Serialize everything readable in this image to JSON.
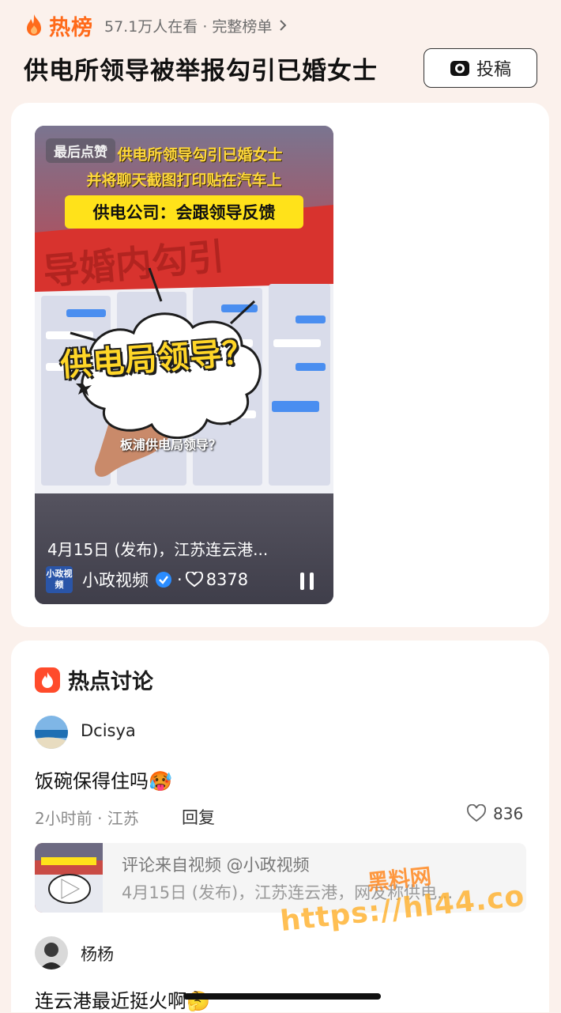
{
  "header": {
    "hot_label": "热榜",
    "viewers": "57.1万人在看 · 完整榜单",
    "title": "供电所领导被举报勾引已婚女士",
    "submit_label": "投稿"
  },
  "video": {
    "last_watched": "最后点赞",
    "caption_line1": "供电所领导勾引已婚女士",
    "caption_line2": "并将聊天截图打印贴在汽车上",
    "caption_line3": "供电公司：会跟领导反馈",
    "burst_text": "供电局领导？",
    "subcaption": "板浦供电局领导？",
    "description": "4月15日 (发布)，江苏连云港...",
    "source_logo": "小政视频",
    "source_name": "小政视频",
    "likes": "8378"
  },
  "discussion": {
    "title": "热点讨论",
    "comments": [
      {
        "user": "Dcisya",
        "text": "饭碗保得住吗🥵",
        "meta": "2小时前 · 江苏",
        "reply_label": "回复",
        "likes": "836"
      },
      {
        "user": "杨杨",
        "text": "连云港最近挺火啊🤔"
      }
    ],
    "ref": {
      "line1": "评论来自视频 @小政视频",
      "line2": "4月15日 (发布)，江苏连云港，网友称供电..."
    }
  },
  "watermark": {
    "line1": "黑料网",
    "line2": "https://hl44.co"
  },
  "colors": {
    "accent": "#ff6a1a",
    "page_bg": "#fbf1ec",
    "card_bg": "#ffffff",
    "verified": "#2a8cff"
  }
}
